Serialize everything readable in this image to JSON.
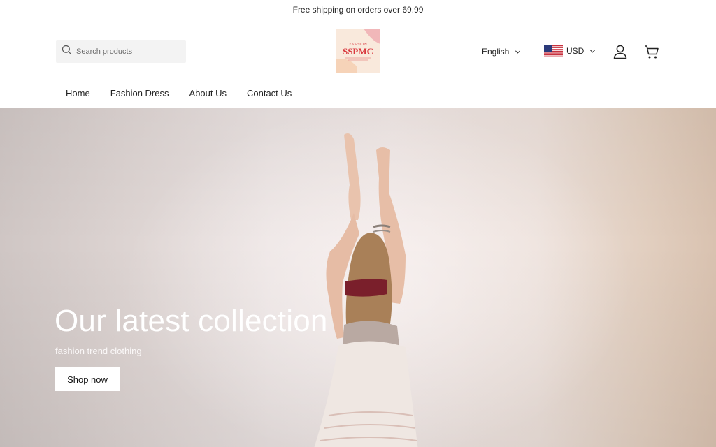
{
  "announcement": "Free shipping on orders over 69.99",
  "search": {
    "placeholder": "Search products"
  },
  "logo": {
    "line1": "FASHION",
    "line2": "SSPMC",
    "colors": {
      "text": "#d9383e",
      "bg": "#f9e9dc",
      "accent": "#f1b7b9"
    }
  },
  "language": {
    "selected": "English"
  },
  "currency": {
    "selected": "USD",
    "flag": "us-flag-icon"
  },
  "icons": {
    "account": "user-icon",
    "cart": "cart-icon",
    "search": "search-icon"
  },
  "nav": {
    "items": [
      {
        "label": "Home"
      },
      {
        "label": "Fashion Dress"
      },
      {
        "label": "About Us"
      },
      {
        "label": "Contact Us"
      }
    ]
  },
  "hero": {
    "title": "Our latest collection",
    "subtitle": "fashion trend clothing",
    "button": "Shop now"
  }
}
